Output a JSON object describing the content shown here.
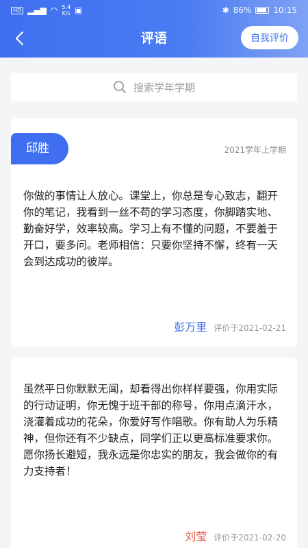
{
  "status": {
    "left_hd": "HD",
    "signal": "⁴ᴳ",
    "speed": "5.4\nK/s",
    "battery": "86%",
    "time": "10:15"
  },
  "header": {
    "back_icon": "‹",
    "title": "评语",
    "self_eval": "自我评价"
  },
  "search": {
    "placeholder": "搜索学年学期"
  },
  "cards": [
    {
      "student": "邱胜",
      "semester": "2021学年上学期",
      "comment": "你做的事情让人放心。课堂上，你总是专心致志，翻开你的笔记，我看到一丝不苟的学习态度，你脚踏实地、勤奋好学，效率较高。学习上有不懂的问题，不要羞于开口，要多问。老师相信：只要你坚持不懈，终有一天会到达成功的彼岸。",
      "teacher": "彭万里",
      "teacher_color": "#3f6ff0",
      "date": "评价于2021-02-21"
    },
    {
      "comment": "虽然平日你默默无闻，却看得出你样样要强，你用实际的行动证明，你无愧于班干部的称号，你用点滴汗水，浇灌着成功的花朵，你爱好写作唱歌。你有助人为乐精神，但你还有不少缺点，同学们正以更高标准要求你。愿你扬长避短，我永远是你忠实的朋友，我会做你的有力支持者！",
      "teacher": "刘莹",
      "teacher_color": "#e8564a",
      "date": "评价于2021-02-20"
    }
  ],
  "colors": {
    "accent": "#3f6ff0",
    "background": "#f4f5f7"
  }
}
